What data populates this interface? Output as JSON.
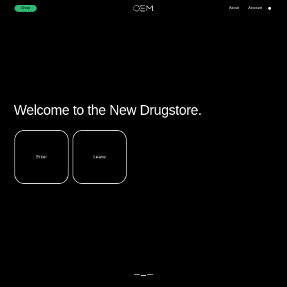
{
  "header": {
    "shop_label": "Shop",
    "logo_text": "OEM",
    "nav": {
      "about": "About",
      "account": "Account"
    },
    "cart_icon": "dot-icon"
  },
  "main": {
    "headline": "Welcome to the New Drugstore.",
    "choices": {
      "enter": "Enter",
      "leave": "Leave"
    }
  },
  "footer": {
    "pager_icon": "slide-indicator-dashes"
  },
  "colors": {
    "background": "#000000",
    "accent": "#2eb872",
    "text": "#f5f5f5"
  }
}
